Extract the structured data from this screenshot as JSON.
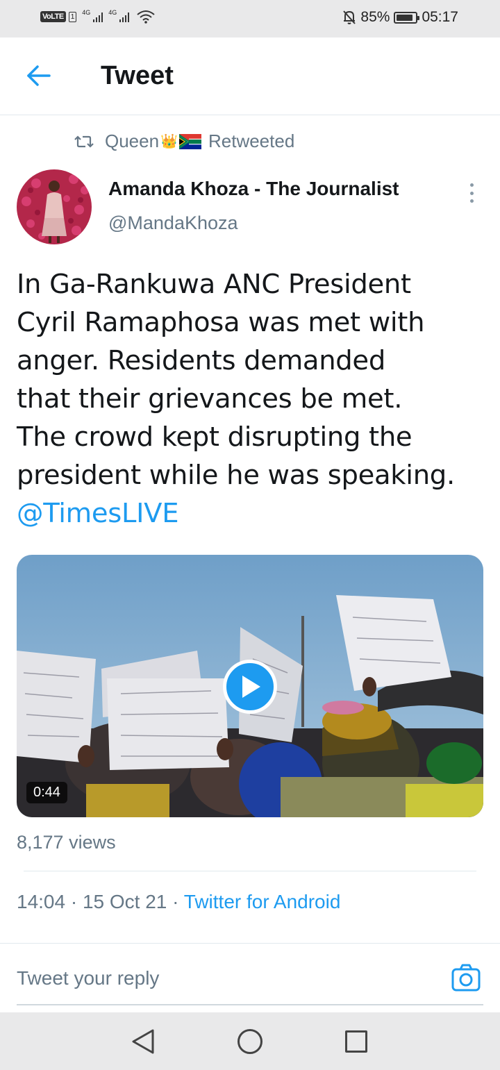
{
  "status_bar": {
    "volte": "VoLTE",
    "sim": "1",
    "net1": "4G",
    "net2": "4G",
    "battery": "85%",
    "battery_level": 0.85,
    "time": "05:17"
  },
  "header": {
    "title": "Tweet"
  },
  "retweet": {
    "by": "Queen",
    "crown": "👑",
    "label": "Retweeted"
  },
  "author": {
    "name": "Amanda Khoza - The Journalist",
    "handle": "@MandaKhoza"
  },
  "tweet": {
    "lines": [
      "In Ga-Rankuwa ANC President",
      "Cyril Ramaphosa was met with",
      "anger. Residents demanded",
      "that their grievances be met.",
      "The crowd kept disrupting the",
      "president while he was speaking."
    ],
    "mention": "@TimesLIVE"
  },
  "media": {
    "duration": "0:44"
  },
  "stats": {
    "views": "8,177 views"
  },
  "meta": {
    "time": "14:04",
    "sep": " · ",
    "date": "15 Oct 21",
    "source": "Twitter for Android"
  },
  "reply": {
    "placeholder": "Tweet your reply"
  },
  "colors": {
    "accent": "#1d9bf0",
    "muted": "#657786",
    "text": "#14171a"
  },
  "icons": {
    "back": "arrow-left-icon",
    "retweet": "retweet-icon",
    "more": "more-vertical-icon",
    "play": "play-icon",
    "camera": "camera-icon"
  }
}
